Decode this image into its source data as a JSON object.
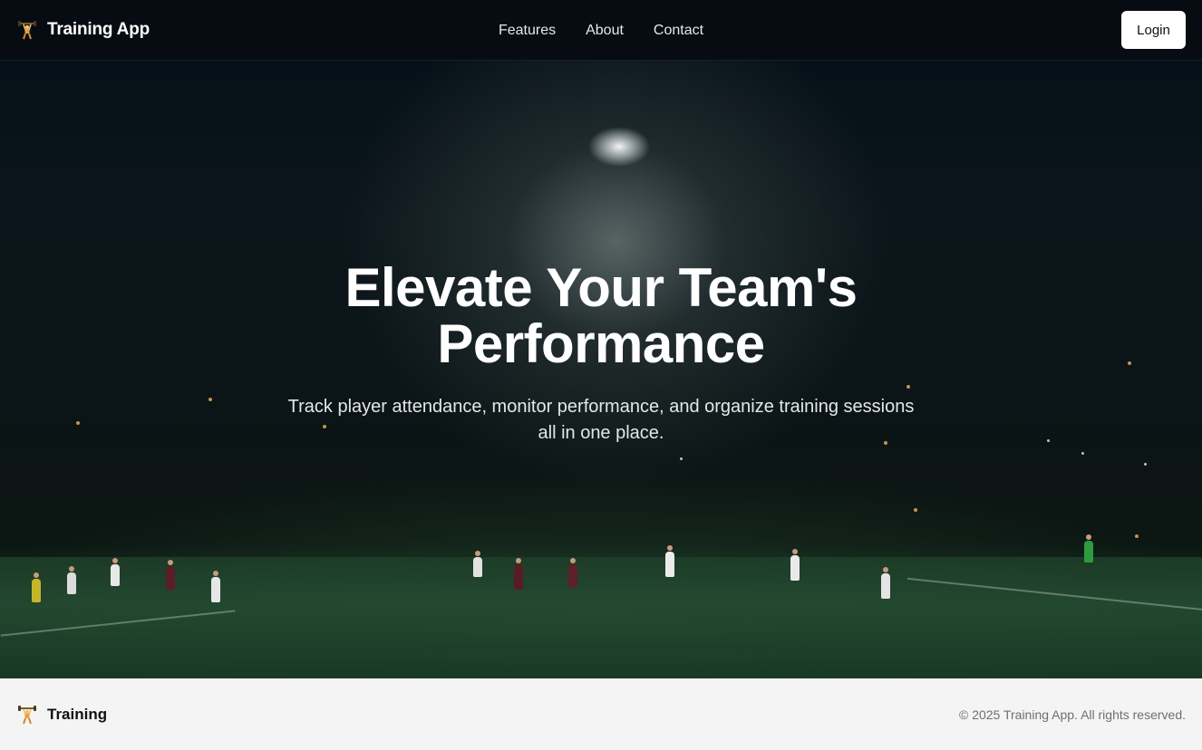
{
  "header": {
    "brand": "Training App",
    "brand_icon": "weightlifter-icon",
    "nav": [
      {
        "label": "Features"
      },
      {
        "label": "About"
      },
      {
        "label": "Contact"
      }
    ],
    "login_label": "Login"
  },
  "hero": {
    "title": "Elevate Your Team's Performance",
    "subtitle": "Track player attendance, monitor performance, and organize training sessions all in one place.",
    "background": "night football pitch under floodlight"
  },
  "footer": {
    "brand": "Training",
    "copyright": "© 2025 Training App. All rights reserved."
  },
  "colors": {
    "nav_bg": "#060c12",
    "footer_bg": "#f4f4f5",
    "hero_text": "#ffffff"
  }
}
